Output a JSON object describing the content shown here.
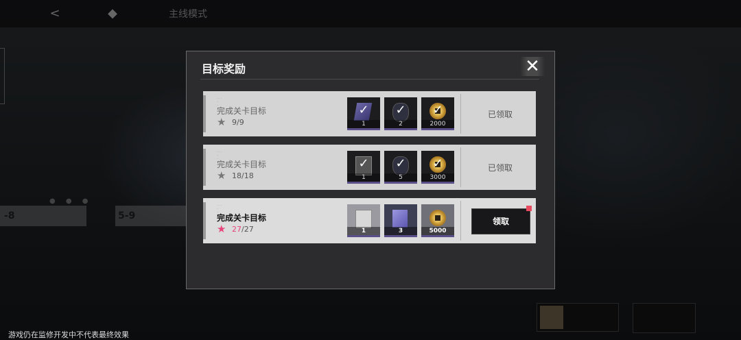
{
  "topbar": {
    "title": "主线模式"
  },
  "disclaimer": "游戏仍在监修开发中不代表最终效果",
  "background": {
    "stage_left": "-8",
    "stage_right": "5-9"
  },
  "modal": {
    "title": "目标奖励",
    "close_icon": "close-icon",
    "rows": [
      {
        "title": "完成关卡目标",
        "progress": "9/9",
        "status": "已领取",
        "items": [
          {
            "icon": "card-icon",
            "qty": "1"
          },
          {
            "icon": "crystal-icon",
            "qty": "2"
          },
          {
            "icon": "coin-icon",
            "qty": "2000"
          }
        ]
      },
      {
        "title": "完成关卡目标",
        "progress": "18/18",
        "status": "已领取",
        "items": [
          {
            "icon": "tag-icon",
            "qty": "1"
          },
          {
            "icon": "crystal-icon",
            "qty": "5"
          },
          {
            "icon": "coin-icon",
            "qty": "3000"
          }
        ]
      },
      {
        "title": "完成关卡目标",
        "progress_current": "27",
        "progress_total": "/27",
        "button": "领取",
        "items": [
          {
            "icon": "tag-icon",
            "qty": "1"
          },
          {
            "icon": "card-icon",
            "qty": "3"
          },
          {
            "icon": "coin-icon",
            "qty": "5000"
          }
        ]
      }
    ]
  },
  "colors": {
    "accent_pink": "#e8437b",
    "alert_red": "#e84a5f",
    "panel": "#2c2c2e"
  }
}
